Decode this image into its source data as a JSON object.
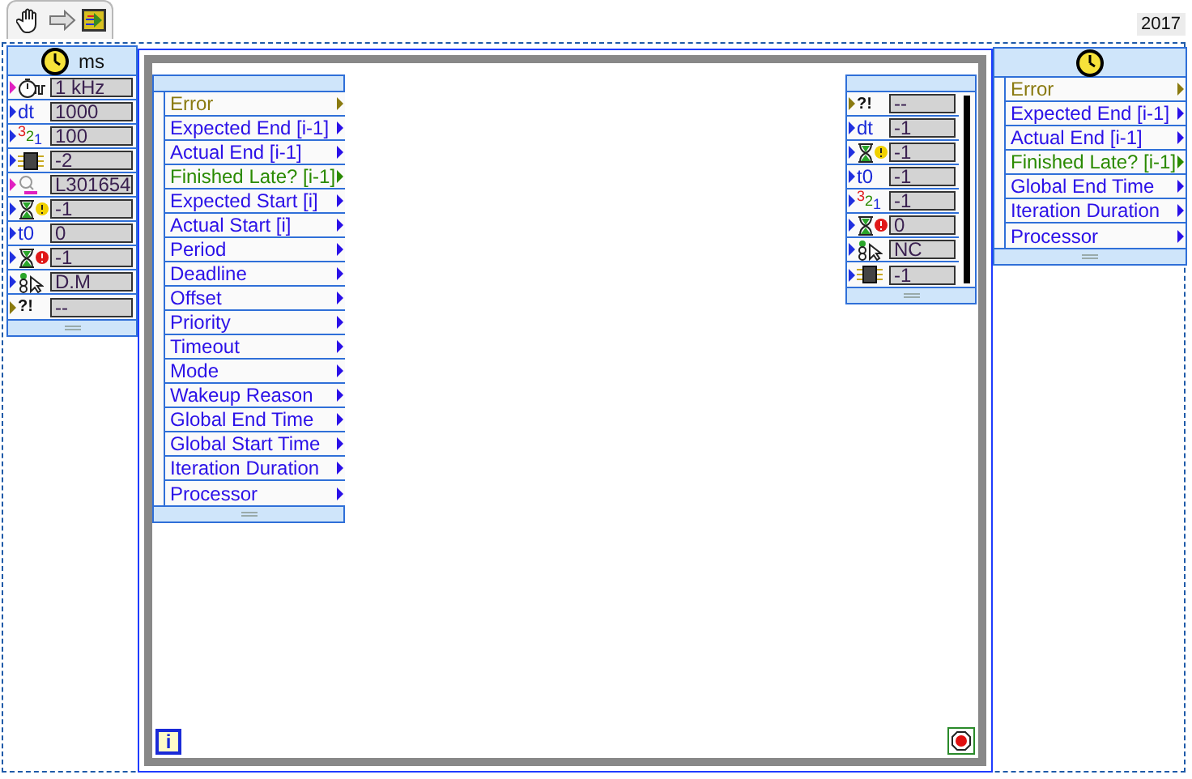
{
  "toolbar": {
    "tools": [
      {
        "kind": "hand"
      },
      {
        "kind": "arrow"
      },
      {
        "kind": "vi"
      }
    ]
  },
  "version": "2017",
  "input_node": {
    "unit": "ms",
    "terminals": [
      {
        "kind": "clock",
        "color": "#e020c0",
        "value": "1 kHz"
      },
      {
        "kind": "label",
        "color": "#2030e0",
        "icon_text": "dt",
        "value": "1000"
      },
      {
        "kind": "priority",
        "color": "#2030e0",
        "icon_text": "321",
        "value": "100"
      },
      {
        "kind": "chip",
        "color": "#2030e0",
        "value": "-2"
      },
      {
        "kind": "name",
        "color": "#e020c0",
        "value": "L301654"
      },
      {
        "kind": "hourglass-warning",
        "color": "#2030e0",
        "value": "-1"
      },
      {
        "kind": "label",
        "color": "#2030e0",
        "icon_text": "t0",
        "value": "0"
      },
      {
        "kind": "hourglass-error",
        "color": "#2030e0",
        "value": "-1"
      },
      {
        "kind": "mode",
        "color": "#2030e0",
        "value": "D.M"
      },
      {
        "kind": "error",
        "color": "#8a7a10",
        "icon_text": "?!",
        "value": "--"
      }
    ]
  },
  "left_data_node": {
    "items": [
      {
        "label": "Error",
        "color": "#8a7a10"
      },
      {
        "label": "Expected End [i-1]",
        "color": "#2a10e8"
      },
      {
        "label": "Actual End [i-1]",
        "color": "#2a10e8"
      },
      {
        "label": "Finished Late? [i-1]",
        "color": "#2a8a00"
      },
      {
        "label": "Expected Start [i]",
        "color": "#2a10e8"
      },
      {
        "label": "Actual Start [i]",
        "color": "#2a10e8"
      },
      {
        "label": "Period",
        "color": "#2a10e8"
      },
      {
        "label": "Deadline",
        "color": "#2a10e8"
      },
      {
        "label": "Offset",
        "color": "#2a10e8"
      },
      {
        "label": "Priority",
        "color": "#2a10e8"
      },
      {
        "label": "Timeout",
        "color": "#2a10e8"
      },
      {
        "label": "Mode",
        "color": "#2a10e8"
      },
      {
        "label": "Wakeup Reason",
        "color": "#2a10e8"
      },
      {
        "label": "Global End Time",
        "color": "#2a10e8"
      },
      {
        "label": "Global Start Time",
        "color": "#2a10e8"
      },
      {
        "label": "Iteration Duration",
        "color": "#2a10e8"
      },
      {
        "label": "Processor",
        "color": "#2a10e8"
      }
    ]
  },
  "right_data_node": {
    "terminals": [
      {
        "kind": "error",
        "color": "#8a7a10",
        "icon_text": "?!",
        "value": "--"
      },
      {
        "kind": "label",
        "color": "#2030e0",
        "icon_text": "dt",
        "value": "-1"
      },
      {
        "kind": "hourglass-warning",
        "color": "#2030e0",
        "value": "-1"
      },
      {
        "kind": "label",
        "color": "#2030e0",
        "icon_text": "t0",
        "value": "-1"
      },
      {
        "kind": "priority",
        "color": "#2030e0",
        "icon_text": "321",
        "value": "-1"
      },
      {
        "kind": "hourglass-error",
        "color": "#2030e0",
        "value": "0"
      },
      {
        "kind": "mode",
        "color": "#2030e0",
        "value": "NC"
      },
      {
        "kind": "chip",
        "color": "#2030e0",
        "value": "-1"
      }
    ]
  },
  "output_node": {
    "items": [
      {
        "label": "Error",
        "color": "#8a7a10"
      },
      {
        "label": "Expected End [i-1]",
        "color": "#2a10e8"
      },
      {
        "label": "Actual End [i-1]",
        "color": "#2a10e8"
      },
      {
        "label": "Finished Late? [i-1]",
        "color": "#2a8a00"
      },
      {
        "label": "Global End Time",
        "color": "#2a10e8"
      },
      {
        "label": "Iteration Duration",
        "color": "#2a10e8"
      },
      {
        "label": "Processor",
        "color": "#2a10e8"
      }
    ]
  },
  "loop": {
    "iteration_label": "i"
  }
}
